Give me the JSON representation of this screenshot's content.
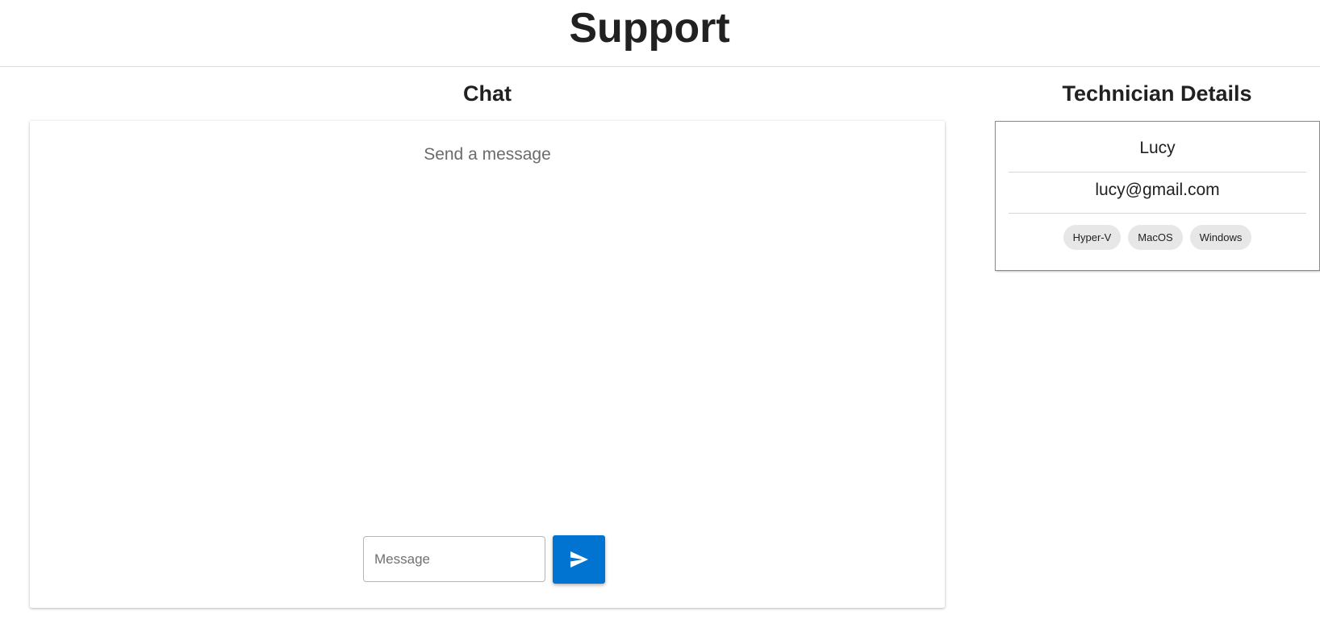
{
  "header": {
    "title": "Support"
  },
  "chat": {
    "heading": "Chat",
    "placeholder": "Send a message",
    "input_placeholder": "Message",
    "input_value": "",
    "send_icon": "send-icon",
    "accent_color": "#0074d0"
  },
  "technician": {
    "heading": "Technician Details",
    "name": "Lucy",
    "email": "lucy@gmail.com",
    "skills": [
      "Hyper-V",
      "MacOS",
      "Windows"
    ]
  }
}
